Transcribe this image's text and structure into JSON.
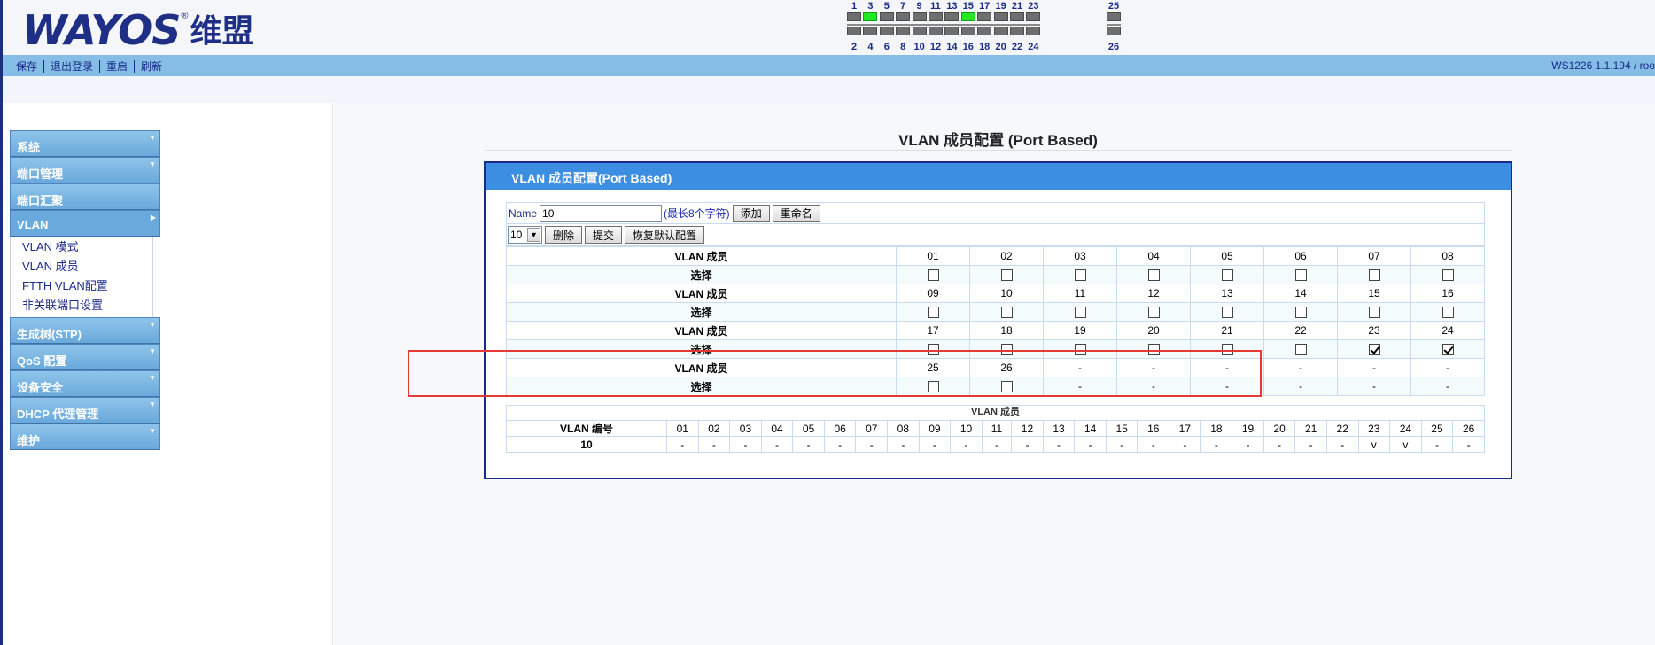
{
  "brand": {
    "logo_text": "WAYOS",
    "logo_reg": "®",
    "logo_cn": "维盟"
  },
  "ports": {
    "top_row": [
      "1",
      "3",
      "5",
      "7",
      "9",
      "11",
      "13",
      "15",
      "17",
      "19",
      "21",
      "23"
    ],
    "bottom_row": [
      "2",
      "4",
      "6",
      "8",
      "10",
      "12",
      "14",
      "16",
      "18",
      "20",
      "22",
      "24"
    ],
    "uplink_top": "25",
    "uplink_bottom": "26",
    "active_ports": [
      "3",
      "15"
    ],
    "led_on_color": "#22e822",
    "led_off_color": "#6e6e6e"
  },
  "topmenu": {
    "save": "保存",
    "logout": "退出登录",
    "reboot": "重启",
    "refresh": "刷新",
    "version": "WS1226  1.1.194 / roo"
  },
  "sidebar": {
    "items": [
      {
        "label": "系统"
      },
      {
        "label": "端口管理"
      },
      {
        "label": "端口汇聚"
      },
      {
        "label": "VLAN"
      }
    ],
    "vlan_sub": [
      {
        "label": "VLAN 模式"
      },
      {
        "label": "VLAN 成员"
      },
      {
        "label": "FTTH VLAN配置"
      },
      {
        "label": "非关联端口设置"
      }
    ],
    "items_after": [
      {
        "label": "生成树(STP)"
      },
      {
        "label": "QoS 配置"
      },
      {
        "label": "设备安全"
      },
      {
        "label": "DHCP 代理管理"
      },
      {
        "label": "维护"
      }
    ]
  },
  "page": {
    "title": "VLAN 成员配置 (Port Based)",
    "panel_title": "VLAN 成员配置(Port Based)"
  },
  "form": {
    "name_label": "Name",
    "name_value": "10",
    "hint": "(最长8个字符)",
    "add_button": "添加",
    "rename_button": "重命名",
    "vlan_select": "10",
    "delete_button": "删除",
    "submit_button": "提交",
    "restore_button": "恢复默认配置",
    "member_label": "VLAN 成员",
    "select_label": "选择",
    "groups": [
      {
        "ports": [
          "01",
          "02",
          "03",
          "04",
          "05",
          "06",
          "07",
          "08"
        ],
        "checked": [
          false,
          false,
          false,
          false,
          false,
          false,
          false,
          false
        ],
        "has_box": [
          true,
          true,
          true,
          true,
          true,
          true,
          true,
          true
        ]
      },
      {
        "ports": [
          "09",
          "10",
          "11",
          "12",
          "13",
          "14",
          "15",
          "16"
        ],
        "checked": [
          false,
          false,
          false,
          false,
          false,
          false,
          false,
          false
        ],
        "has_box": [
          true,
          true,
          true,
          true,
          true,
          true,
          true,
          true
        ]
      },
      {
        "ports": [
          "17",
          "18",
          "19",
          "20",
          "21",
          "22",
          "23",
          "24"
        ],
        "checked": [
          false,
          false,
          false,
          false,
          false,
          false,
          true,
          true
        ],
        "has_box": [
          true,
          true,
          true,
          true,
          true,
          true,
          true,
          true
        ]
      },
      {
        "ports": [
          "25",
          "26",
          "-",
          "-",
          "-",
          "-",
          "-",
          "-"
        ],
        "checked": [
          false,
          false,
          false,
          false,
          false,
          false,
          false,
          false
        ],
        "has_box": [
          true,
          true,
          false,
          false,
          false,
          false,
          false,
          false
        ]
      }
    ]
  },
  "summary": {
    "title": "VLAN 成员",
    "id_header": "VLAN 编号",
    "ports": [
      "01",
      "02",
      "03",
      "04",
      "05",
      "06",
      "07",
      "08",
      "09",
      "10",
      "11",
      "12",
      "13",
      "14",
      "15",
      "16",
      "17",
      "18",
      "19",
      "20",
      "21",
      "22",
      "23",
      "24",
      "25",
      "26"
    ],
    "rows": [
      {
        "vlan": "10",
        "members": [
          "-",
          "-",
          "-",
          "-",
          "-",
          "-",
          "-",
          "-",
          "-",
          "-",
          "-",
          "-",
          "-",
          "-",
          "-",
          "-",
          "-",
          "-",
          "-",
          "-",
          "-",
          "-",
          "v",
          "v",
          "-",
          "-"
        ]
      }
    ]
  }
}
